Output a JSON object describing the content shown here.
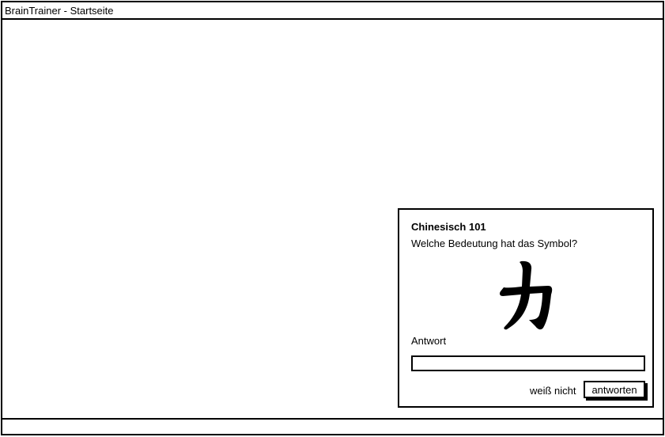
{
  "window": {
    "title": "BrainTrainer - Startseite"
  },
  "quiz": {
    "course_title": "Chinesisch 101",
    "question": "Welche Bedeutung hat das Symbol?",
    "symbol": "力",
    "answer_label": "Antwort",
    "answer_value": "",
    "answer_placeholder": "",
    "dont_know_label": "weiß nicht",
    "submit_label": "antworten"
  }
}
